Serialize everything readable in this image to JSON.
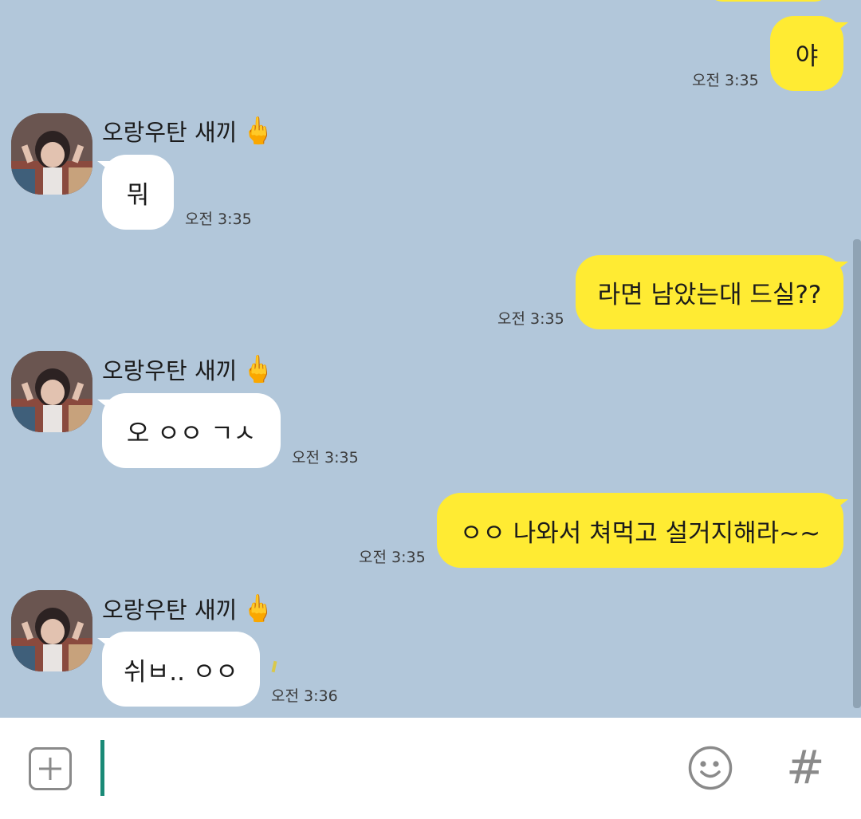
{
  "colors": {
    "chat_background": "#b2c7da",
    "my_bubble": "#ffeb33",
    "their_bubble": "#ffffff",
    "cursor": "#1a8a77",
    "icon_gray": "#8a8a8a"
  },
  "partner": {
    "name": "오랑우탄 새끼",
    "name_emoji": "🖕",
    "avatar": "profile-photo"
  },
  "messages": [
    {
      "from": "me",
      "text": "야",
      "time": "오전 3:35"
    },
    {
      "from": "partner",
      "text": "뭐",
      "time": "오전 3:35"
    },
    {
      "from": "me",
      "text": "라면 남았는대 드실??",
      "time": "오전 3:35"
    },
    {
      "from": "partner",
      "text": "오 ㅇㅇ ㄱㅅ",
      "time": "오전 3:35"
    },
    {
      "from": "me",
      "text": "ㅇㅇ 나와서 쳐먹고 설거지해라~~",
      "time": "오전 3:35"
    },
    {
      "from": "partner",
      "text": "쉬ㅂ.. ㅇㅇ",
      "time": "오전 3:36"
    }
  ],
  "input_bar": {
    "add_icon": "plus-square-icon",
    "emoji_icon": "smiley-icon",
    "hash_label": "#"
  }
}
